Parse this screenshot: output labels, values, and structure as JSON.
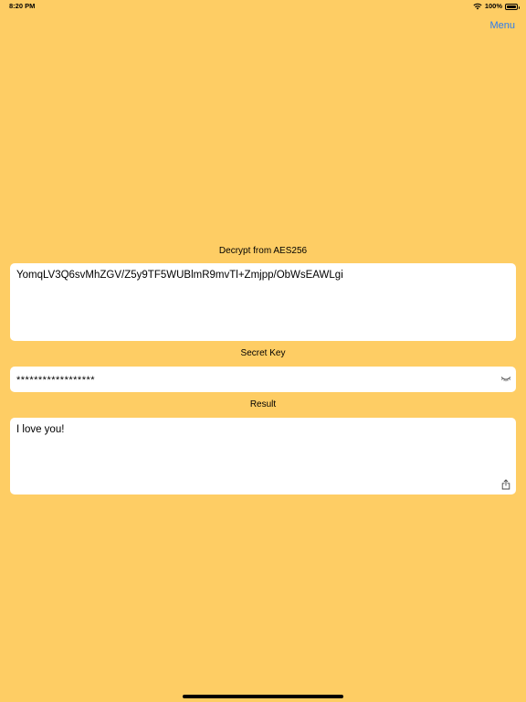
{
  "status_bar": {
    "time": "8:20 PM",
    "battery_percent_label": "100%",
    "battery_level": 1.0,
    "icons": [
      "wifi-icon",
      "battery-icon"
    ]
  },
  "nav": {
    "menu_label": "Menu"
  },
  "decrypt": {
    "label": "Decrypt from AES256",
    "ciphertext": "YomqLV3Q6svMhZGV/Z5y9TF5WUBlmR9mvTl+Zmjpp/ObWsEAWLgi"
  },
  "secret": {
    "label": "Secret Key",
    "masked_value": "******************",
    "toggle_icon": "eye-closed-icon"
  },
  "result": {
    "label": "Result",
    "value": "I love you!",
    "share_icon": "share-icon"
  },
  "colors": {
    "background": "#FECD64",
    "accent": "#2B7BF0",
    "field_background": "#FFFFFF"
  }
}
